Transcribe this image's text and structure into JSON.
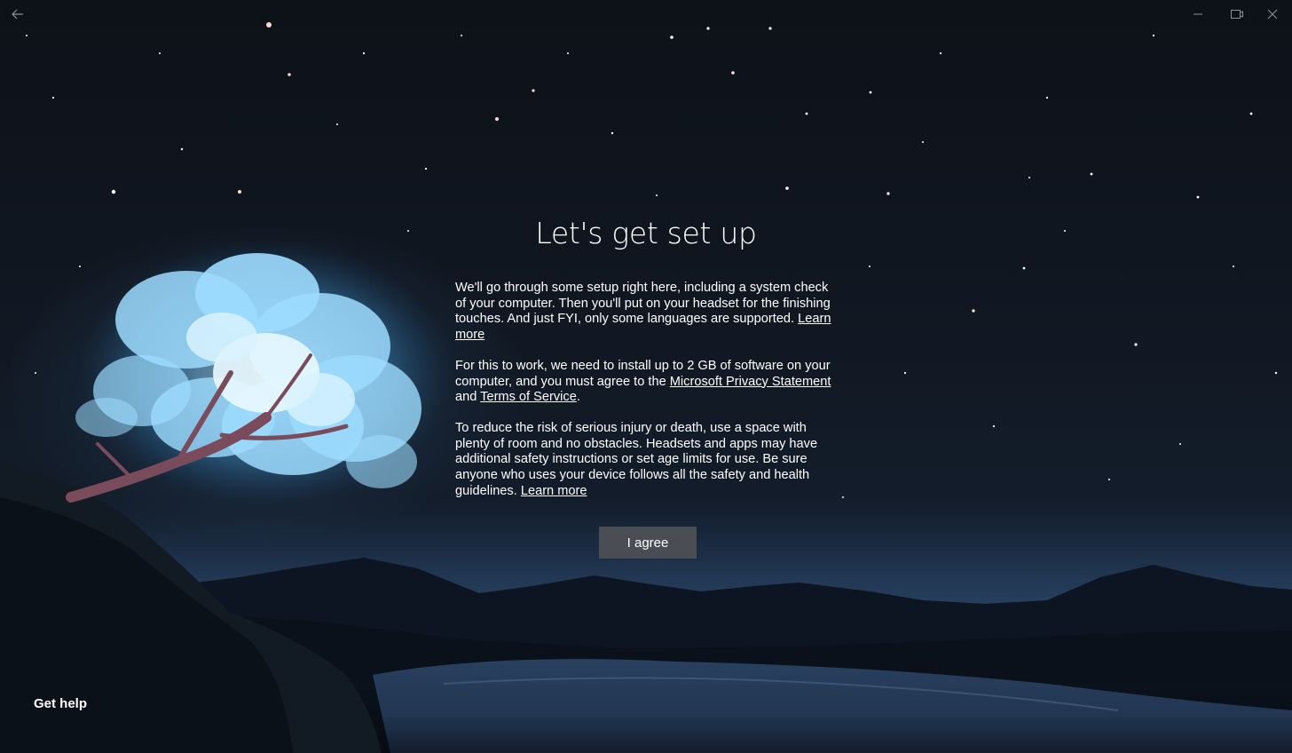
{
  "window": {
    "back_icon": "arrow-left-icon",
    "minimize_icon": "minimize-icon",
    "maximize_icon": "maximize-icon",
    "close_icon": "close-icon"
  },
  "main": {
    "title": "Let's get set up",
    "p1": {
      "text": "We'll go through some setup right here, including a system check of your computer. Then you'll put on your headset for the finishing touches. And just FYI, only some languages are supported.",
      "link": "Learn more"
    },
    "p2": {
      "text_before": "For this to work, we need to install up to 2 GB of software on your computer, and you must agree to the",
      "link_privacy": "Microsoft Privacy Statement",
      "text_and": "and",
      "link_terms": "Terms of Service",
      "text_end": "."
    },
    "p3": {
      "text": "To reduce the risk of serious injury or death, use a space with plenty of room and no obstacles. Headsets and apps may have additional safety instructions or set age limits for use. Be sure anyone who uses your device follows all the safety and health guidelines.",
      "link": "Learn more"
    },
    "agree_button": "I agree"
  },
  "footer": {
    "get_help": "Get help"
  },
  "colors": {
    "button_bg": "#4a4d53",
    "text": "#ffffff",
    "tree_glow": "#8fd6ff"
  }
}
